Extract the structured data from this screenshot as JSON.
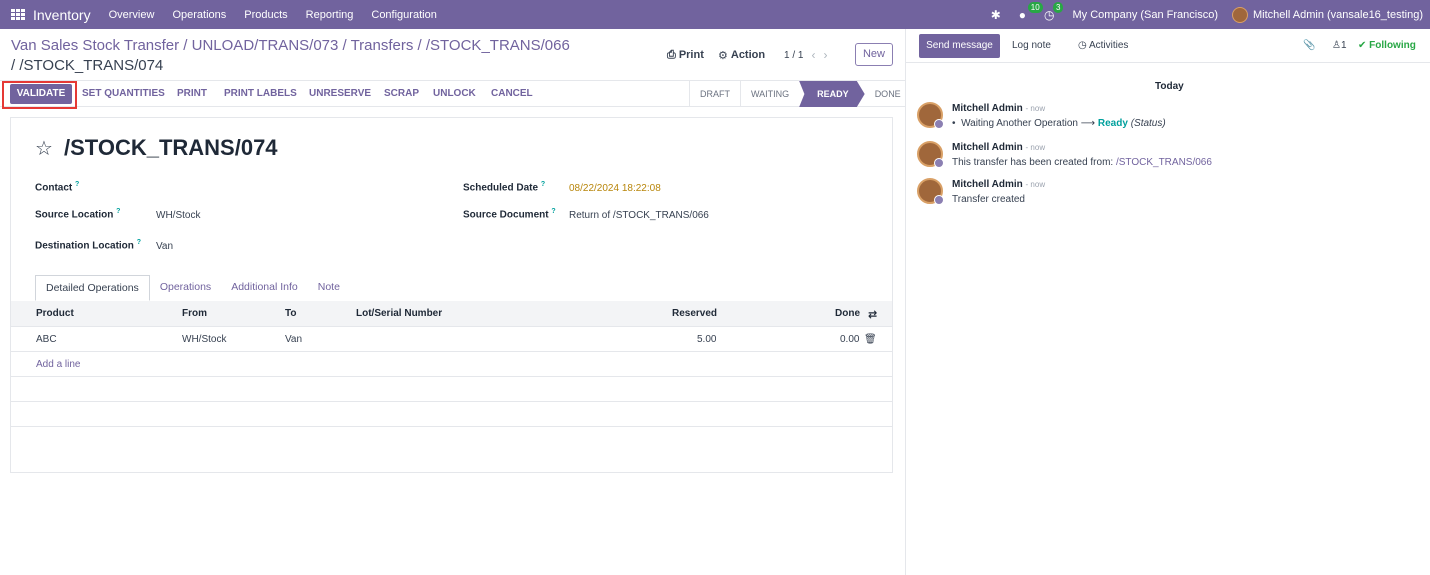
{
  "topnav": {
    "brand": "Inventory",
    "menus": [
      "Overview",
      "Operations",
      "Products",
      "Reporting",
      "Configuration"
    ],
    "messages_count": "10",
    "activities_count": "3",
    "company": "My Company (San Francisco)",
    "user": "Mitchell Admin (vansale16_testing)"
  },
  "breadcrumb": {
    "line1": "Van Sales Stock Transfer / UNLOAD/TRANS/073 / Transfers / /STOCK_TRANS/066",
    "current": " / /STOCK_TRANS/074"
  },
  "controls": {
    "print": "Print",
    "action": "Action",
    "pager": "1 / 1",
    "new": "New"
  },
  "actions": {
    "validate": "VALIDATE",
    "set_quantities": "SET QUANTITIES",
    "print": "PRINT",
    "print_labels": "PRINT LABELS",
    "unreserve": "UNRESERVE",
    "scrap": "SCRAP",
    "unlock": "UNLOCK",
    "cancel": "CANCEL"
  },
  "status": {
    "draft": "DRAFT",
    "waiting": "WAITING",
    "ready": "READY",
    "done": "DONE"
  },
  "form": {
    "title": "/STOCK_TRANS/074",
    "contact_label": "Contact",
    "source_location_label": "Source Location",
    "source_location": "WH/Stock",
    "destination_location_label": "Destination Location",
    "destination_location": "Van",
    "scheduled_date_label": "Scheduled Date",
    "scheduled_date": "08/22/2024 18:22:08",
    "source_document_label": "Source Document",
    "source_document": "Return of /STOCK_TRANS/066"
  },
  "tabs": [
    "Detailed Operations",
    "Operations",
    "Additional Info",
    "Note"
  ],
  "table": {
    "headers": {
      "product": "Product",
      "from": "From",
      "to": "To",
      "lot": "Lot/Serial Number",
      "reserved": "Reserved",
      "done": "Done"
    },
    "rows": [
      {
        "product": "ABC",
        "from": "WH/Stock",
        "to": "Van",
        "lot": "",
        "reserved": "5.00",
        "done": "0.00"
      }
    ],
    "add_line": "Add a line"
  },
  "chatter": {
    "send_message": "Send message",
    "log_note": "Log note",
    "activities": "Activities",
    "followers": "1",
    "following": "Following",
    "date_separator": "Today",
    "messages": [
      {
        "author": "Mitchell Admin",
        "time": "now",
        "old": "Waiting Another Operation",
        "new": "Ready",
        "field": "(Status)"
      },
      {
        "author": "Mitchell Admin",
        "time": "now",
        "text": "This transfer has been created from: ",
        "link": "/STOCK_TRANS/066"
      },
      {
        "author": "Mitchell Admin",
        "time": "now",
        "text": "Transfer created"
      }
    ]
  }
}
